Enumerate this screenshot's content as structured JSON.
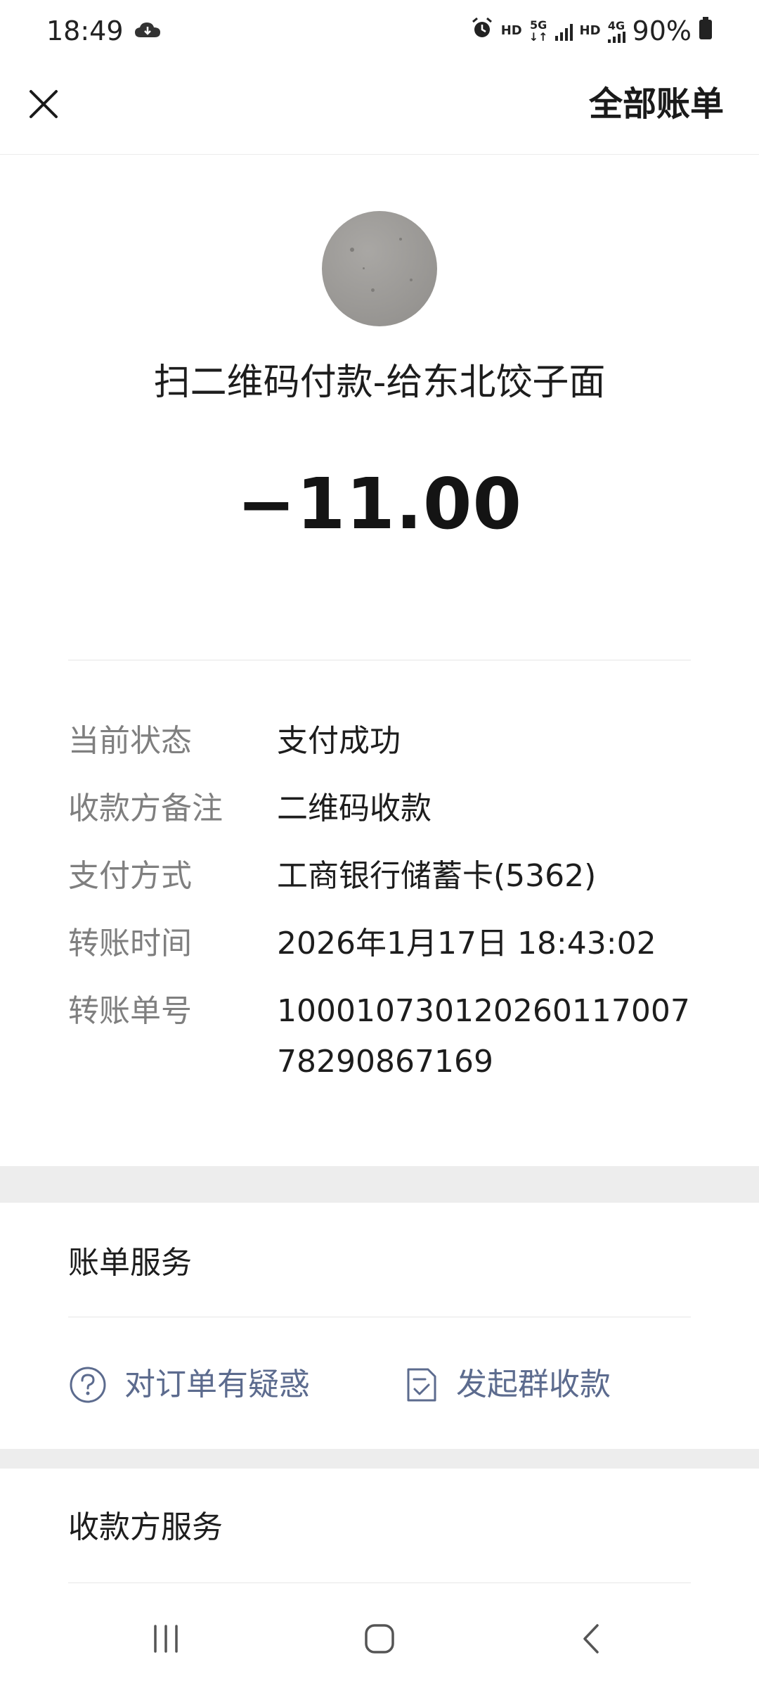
{
  "status_bar": {
    "time": "18:49",
    "hd1": "HD",
    "net_5g": "5G",
    "hd2": "HD",
    "net_4g": "4G",
    "battery": "90%",
    "icons": [
      "cloud-icon",
      "alarm-icon",
      "signal-icon",
      "battery-icon"
    ]
  },
  "header": {
    "close_icon": "close-icon",
    "all_bills": "全部账单"
  },
  "merchant": {
    "title": "扫二维码付款-给东北饺子面",
    "amount": "−11.00"
  },
  "details": [
    {
      "label": "当前状态",
      "value": "支付成功"
    },
    {
      "label": "收款方备注",
      "value": "二维码收款"
    },
    {
      "label": "支付方式",
      "value": "工商银行储蓄卡(5362)"
    },
    {
      "label": "转账时间",
      "value": "2026年1月17日 18:43:02"
    },
    {
      "label": "转账单号",
      "value": "100010730120260117007782908671​69"
    }
  ],
  "bill_service": {
    "title": "账单服务",
    "question_action": "对订单有疑惑",
    "group_action": "发起群收款",
    "accent_color": "#5c6b8e"
  },
  "payee_service": {
    "title": "收款方服务"
  },
  "nav": {
    "icons": [
      "recents-icon",
      "home-icon",
      "back-icon"
    ]
  }
}
